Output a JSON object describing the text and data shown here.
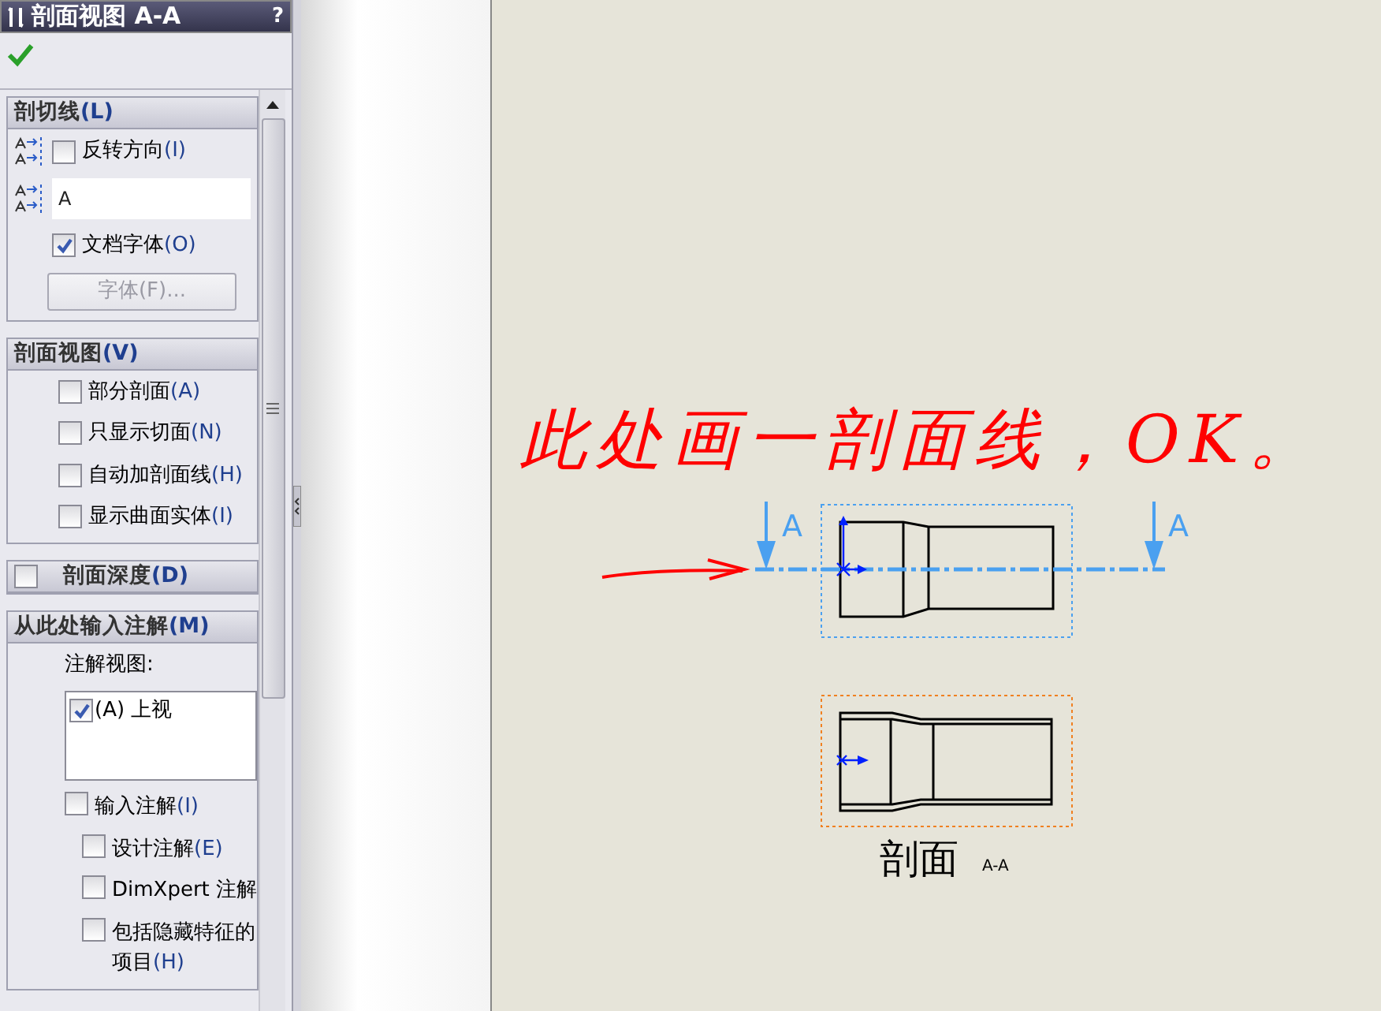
{
  "property_manager": {
    "title": "剖面视图 A-A",
    "help": "?"
  },
  "cutting_line": {
    "title": "剖切线",
    "key": "(L)",
    "reverse": {
      "label": "反转方向",
      "key": "(I)",
      "checked": false
    },
    "label_value": "A",
    "doc_font": {
      "label": "文档字体",
      "key": "(O)",
      "checked": true
    },
    "font_button": {
      "label": "字体(F)...",
      "disabled": true
    }
  },
  "section_view": {
    "title": "剖面视图",
    "key": "(V)",
    "options": [
      {
        "label": "部分剖面",
        "key": "(A)",
        "checked": false
      },
      {
        "label": "只显示切面",
        "key": "(N)",
        "checked": false
      },
      {
        "label": "自动加剖面线",
        "key": "(H)",
        "checked": false
      },
      {
        "label": "显示曲面实体",
        "key": "(I)",
        "checked": false
      }
    ]
  },
  "section_depth": {
    "title": "剖面深度",
    "key": "(D)",
    "checked": false
  },
  "import_annotations": {
    "title": "从此处输入注解",
    "key": "(M)",
    "views_label": "注解视图:",
    "views": [
      {
        "label": "(A) 上视",
        "checked": true
      }
    ],
    "options": [
      {
        "label": "输入注解",
        "key": "(I)",
        "checked": false,
        "children": [
          {
            "label": "设计注解",
            "key": "(E)",
            "checked": false
          },
          {
            "label": "DimXpert 注解",
            "checked": false
          },
          {
            "label": "包括隐藏特征的项目",
            "key": "(H)",
            "checked": false
          }
        ]
      }
    ]
  },
  "drawing_sheet": {
    "note": "此处画一剖面线，OK。",
    "section_letters": [
      "A",
      "A"
    ],
    "section_view_label": "剖面",
    "section_view_id": "A-A"
  }
}
